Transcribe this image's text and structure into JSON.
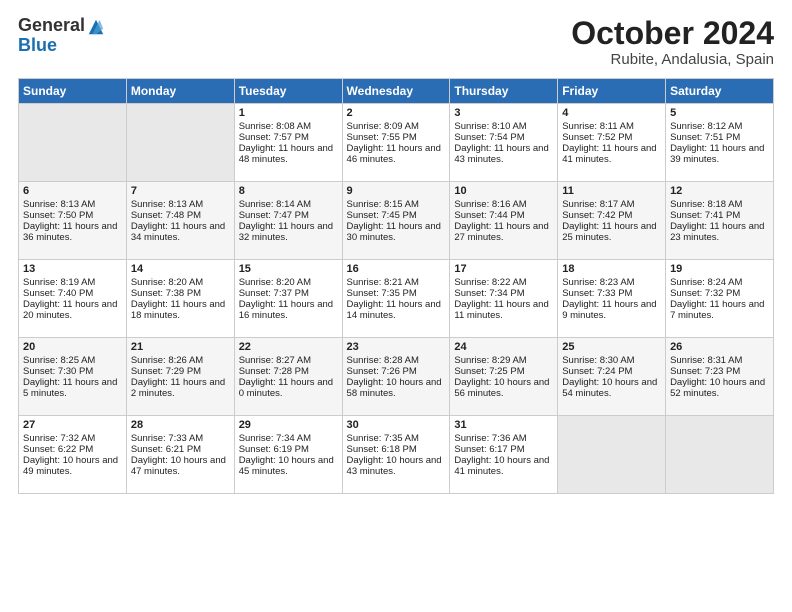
{
  "logo": {
    "general": "General",
    "blue": "Blue"
  },
  "title": "October 2024",
  "location": "Rubite, Andalusia, Spain",
  "days_header": [
    "Sunday",
    "Monday",
    "Tuesday",
    "Wednesday",
    "Thursday",
    "Friday",
    "Saturday"
  ],
  "weeks": [
    [
      {
        "num": "",
        "lines": []
      },
      {
        "num": "",
        "lines": []
      },
      {
        "num": "1",
        "lines": [
          "Sunrise: 8:08 AM",
          "Sunset: 7:57 PM",
          "Daylight: 11 hours and 48 minutes."
        ]
      },
      {
        "num": "2",
        "lines": [
          "Sunrise: 8:09 AM",
          "Sunset: 7:55 PM",
          "Daylight: 11 hours and 46 minutes."
        ]
      },
      {
        "num": "3",
        "lines": [
          "Sunrise: 8:10 AM",
          "Sunset: 7:54 PM",
          "Daylight: 11 hours and 43 minutes."
        ]
      },
      {
        "num": "4",
        "lines": [
          "Sunrise: 8:11 AM",
          "Sunset: 7:52 PM",
          "Daylight: 11 hours and 41 minutes."
        ]
      },
      {
        "num": "5",
        "lines": [
          "Sunrise: 8:12 AM",
          "Sunset: 7:51 PM",
          "Daylight: 11 hours and 39 minutes."
        ]
      }
    ],
    [
      {
        "num": "6",
        "lines": [
          "Sunrise: 8:13 AM",
          "Sunset: 7:50 PM",
          "Daylight: 11 hours and 36 minutes."
        ]
      },
      {
        "num": "7",
        "lines": [
          "Sunrise: 8:13 AM",
          "Sunset: 7:48 PM",
          "Daylight: 11 hours and 34 minutes."
        ]
      },
      {
        "num": "8",
        "lines": [
          "Sunrise: 8:14 AM",
          "Sunset: 7:47 PM",
          "Daylight: 11 hours and 32 minutes."
        ]
      },
      {
        "num": "9",
        "lines": [
          "Sunrise: 8:15 AM",
          "Sunset: 7:45 PM",
          "Daylight: 11 hours and 30 minutes."
        ]
      },
      {
        "num": "10",
        "lines": [
          "Sunrise: 8:16 AM",
          "Sunset: 7:44 PM",
          "Daylight: 11 hours and 27 minutes."
        ]
      },
      {
        "num": "11",
        "lines": [
          "Sunrise: 8:17 AM",
          "Sunset: 7:42 PM",
          "Daylight: 11 hours and 25 minutes."
        ]
      },
      {
        "num": "12",
        "lines": [
          "Sunrise: 8:18 AM",
          "Sunset: 7:41 PM",
          "Daylight: 11 hours and 23 minutes."
        ]
      }
    ],
    [
      {
        "num": "13",
        "lines": [
          "Sunrise: 8:19 AM",
          "Sunset: 7:40 PM",
          "Daylight: 11 hours and 20 minutes."
        ]
      },
      {
        "num": "14",
        "lines": [
          "Sunrise: 8:20 AM",
          "Sunset: 7:38 PM",
          "Daylight: 11 hours and 18 minutes."
        ]
      },
      {
        "num": "15",
        "lines": [
          "Sunrise: 8:20 AM",
          "Sunset: 7:37 PM",
          "Daylight: 11 hours and 16 minutes."
        ]
      },
      {
        "num": "16",
        "lines": [
          "Sunrise: 8:21 AM",
          "Sunset: 7:35 PM",
          "Daylight: 11 hours and 14 minutes."
        ]
      },
      {
        "num": "17",
        "lines": [
          "Sunrise: 8:22 AM",
          "Sunset: 7:34 PM",
          "Daylight: 11 hours and 11 minutes."
        ]
      },
      {
        "num": "18",
        "lines": [
          "Sunrise: 8:23 AM",
          "Sunset: 7:33 PM",
          "Daylight: 11 hours and 9 minutes."
        ]
      },
      {
        "num": "19",
        "lines": [
          "Sunrise: 8:24 AM",
          "Sunset: 7:32 PM",
          "Daylight: 11 hours and 7 minutes."
        ]
      }
    ],
    [
      {
        "num": "20",
        "lines": [
          "Sunrise: 8:25 AM",
          "Sunset: 7:30 PM",
          "Daylight: 11 hours and 5 minutes."
        ]
      },
      {
        "num": "21",
        "lines": [
          "Sunrise: 8:26 AM",
          "Sunset: 7:29 PM",
          "Daylight: 11 hours and 2 minutes."
        ]
      },
      {
        "num": "22",
        "lines": [
          "Sunrise: 8:27 AM",
          "Sunset: 7:28 PM",
          "Daylight: 11 hours and 0 minutes."
        ]
      },
      {
        "num": "23",
        "lines": [
          "Sunrise: 8:28 AM",
          "Sunset: 7:26 PM",
          "Daylight: 10 hours and 58 minutes."
        ]
      },
      {
        "num": "24",
        "lines": [
          "Sunrise: 8:29 AM",
          "Sunset: 7:25 PM",
          "Daylight: 10 hours and 56 minutes."
        ]
      },
      {
        "num": "25",
        "lines": [
          "Sunrise: 8:30 AM",
          "Sunset: 7:24 PM",
          "Daylight: 10 hours and 54 minutes."
        ]
      },
      {
        "num": "26",
        "lines": [
          "Sunrise: 8:31 AM",
          "Sunset: 7:23 PM",
          "Daylight: 10 hours and 52 minutes."
        ]
      }
    ],
    [
      {
        "num": "27",
        "lines": [
          "Sunrise: 7:32 AM",
          "Sunset: 6:22 PM",
          "Daylight: 10 hours and 49 minutes."
        ]
      },
      {
        "num": "28",
        "lines": [
          "Sunrise: 7:33 AM",
          "Sunset: 6:21 PM",
          "Daylight: 10 hours and 47 minutes."
        ]
      },
      {
        "num": "29",
        "lines": [
          "Sunrise: 7:34 AM",
          "Sunset: 6:19 PM",
          "Daylight: 10 hours and 45 minutes."
        ]
      },
      {
        "num": "30",
        "lines": [
          "Sunrise: 7:35 AM",
          "Sunset: 6:18 PM",
          "Daylight: 10 hours and 43 minutes."
        ]
      },
      {
        "num": "31",
        "lines": [
          "Sunrise: 7:36 AM",
          "Sunset: 6:17 PM",
          "Daylight: 10 hours and 41 minutes."
        ]
      },
      {
        "num": "",
        "lines": []
      },
      {
        "num": "",
        "lines": []
      }
    ]
  ]
}
